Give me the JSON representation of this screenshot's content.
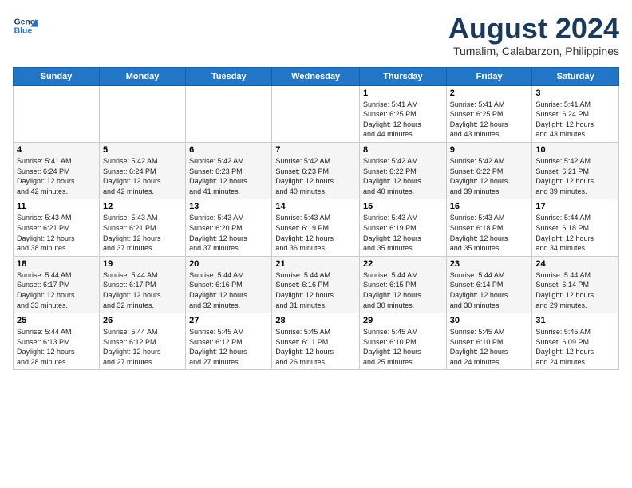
{
  "header": {
    "logo_line1": "General",
    "logo_line2": "Blue",
    "title": "August 2024",
    "subtitle": "Tumalim, Calabarzon, Philippines"
  },
  "days_of_week": [
    "Sunday",
    "Monday",
    "Tuesday",
    "Wednesday",
    "Thursday",
    "Friday",
    "Saturday"
  ],
  "weeks": [
    [
      {
        "day": "",
        "info": ""
      },
      {
        "day": "",
        "info": ""
      },
      {
        "day": "",
        "info": ""
      },
      {
        "day": "",
        "info": ""
      },
      {
        "day": "1",
        "info": "Sunrise: 5:41 AM\nSunset: 6:25 PM\nDaylight: 12 hours\nand 44 minutes."
      },
      {
        "day": "2",
        "info": "Sunrise: 5:41 AM\nSunset: 6:25 PM\nDaylight: 12 hours\nand 43 minutes."
      },
      {
        "day": "3",
        "info": "Sunrise: 5:41 AM\nSunset: 6:24 PM\nDaylight: 12 hours\nand 43 minutes."
      }
    ],
    [
      {
        "day": "4",
        "info": "Sunrise: 5:41 AM\nSunset: 6:24 PM\nDaylight: 12 hours\nand 42 minutes."
      },
      {
        "day": "5",
        "info": "Sunrise: 5:42 AM\nSunset: 6:24 PM\nDaylight: 12 hours\nand 42 minutes."
      },
      {
        "day": "6",
        "info": "Sunrise: 5:42 AM\nSunset: 6:23 PM\nDaylight: 12 hours\nand 41 minutes."
      },
      {
        "day": "7",
        "info": "Sunrise: 5:42 AM\nSunset: 6:23 PM\nDaylight: 12 hours\nand 40 minutes."
      },
      {
        "day": "8",
        "info": "Sunrise: 5:42 AM\nSunset: 6:22 PM\nDaylight: 12 hours\nand 40 minutes."
      },
      {
        "day": "9",
        "info": "Sunrise: 5:42 AM\nSunset: 6:22 PM\nDaylight: 12 hours\nand 39 minutes."
      },
      {
        "day": "10",
        "info": "Sunrise: 5:42 AM\nSunset: 6:21 PM\nDaylight: 12 hours\nand 39 minutes."
      }
    ],
    [
      {
        "day": "11",
        "info": "Sunrise: 5:43 AM\nSunset: 6:21 PM\nDaylight: 12 hours\nand 38 minutes."
      },
      {
        "day": "12",
        "info": "Sunrise: 5:43 AM\nSunset: 6:21 PM\nDaylight: 12 hours\nand 37 minutes."
      },
      {
        "day": "13",
        "info": "Sunrise: 5:43 AM\nSunset: 6:20 PM\nDaylight: 12 hours\nand 37 minutes."
      },
      {
        "day": "14",
        "info": "Sunrise: 5:43 AM\nSunset: 6:19 PM\nDaylight: 12 hours\nand 36 minutes."
      },
      {
        "day": "15",
        "info": "Sunrise: 5:43 AM\nSunset: 6:19 PM\nDaylight: 12 hours\nand 35 minutes."
      },
      {
        "day": "16",
        "info": "Sunrise: 5:43 AM\nSunset: 6:18 PM\nDaylight: 12 hours\nand 35 minutes."
      },
      {
        "day": "17",
        "info": "Sunrise: 5:44 AM\nSunset: 6:18 PM\nDaylight: 12 hours\nand 34 minutes."
      }
    ],
    [
      {
        "day": "18",
        "info": "Sunrise: 5:44 AM\nSunset: 6:17 PM\nDaylight: 12 hours\nand 33 minutes."
      },
      {
        "day": "19",
        "info": "Sunrise: 5:44 AM\nSunset: 6:17 PM\nDaylight: 12 hours\nand 32 minutes."
      },
      {
        "day": "20",
        "info": "Sunrise: 5:44 AM\nSunset: 6:16 PM\nDaylight: 12 hours\nand 32 minutes."
      },
      {
        "day": "21",
        "info": "Sunrise: 5:44 AM\nSunset: 6:16 PM\nDaylight: 12 hours\nand 31 minutes."
      },
      {
        "day": "22",
        "info": "Sunrise: 5:44 AM\nSunset: 6:15 PM\nDaylight: 12 hours\nand 30 minutes."
      },
      {
        "day": "23",
        "info": "Sunrise: 5:44 AM\nSunset: 6:14 PM\nDaylight: 12 hours\nand 30 minutes."
      },
      {
        "day": "24",
        "info": "Sunrise: 5:44 AM\nSunset: 6:14 PM\nDaylight: 12 hours\nand 29 minutes."
      }
    ],
    [
      {
        "day": "25",
        "info": "Sunrise: 5:44 AM\nSunset: 6:13 PM\nDaylight: 12 hours\nand 28 minutes."
      },
      {
        "day": "26",
        "info": "Sunrise: 5:44 AM\nSunset: 6:12 PM\nDaylight: 12 hours\nand 27 minutes."
      },
      {
        "day": "27",
        "info": "Sunrise: 5:45 AM\nSunset: 6:12 PM\nDaylight: 12 hours\nand 27 minutes."
      },
      {
        "day": "28",
        "info": "Sunrise: 5:45 AM\nSunset: 6:11 PM\nDaylight: 12 hours\nand 26 minutes."
      },
      {
        "day": "29",
        "info": "Sunrise: 5:45 AM\nSunset: 6:10 PM\nDaylight: 12 hours\nand 25 minutes."
      },
      {
        "day": "30",
        "info": "Sunrise: 5:45 AM\nSunset: 6:10 PM\nDaylight: 12 hours\nand 24 minutes."
      },
      {
        "day": "31",
        "info": "Sunrise: 5:45 AM\nSunset: 6:09 PM\nDaylight: 12 hours\nand 24 minutes."
      }
    ]
  ]
}
